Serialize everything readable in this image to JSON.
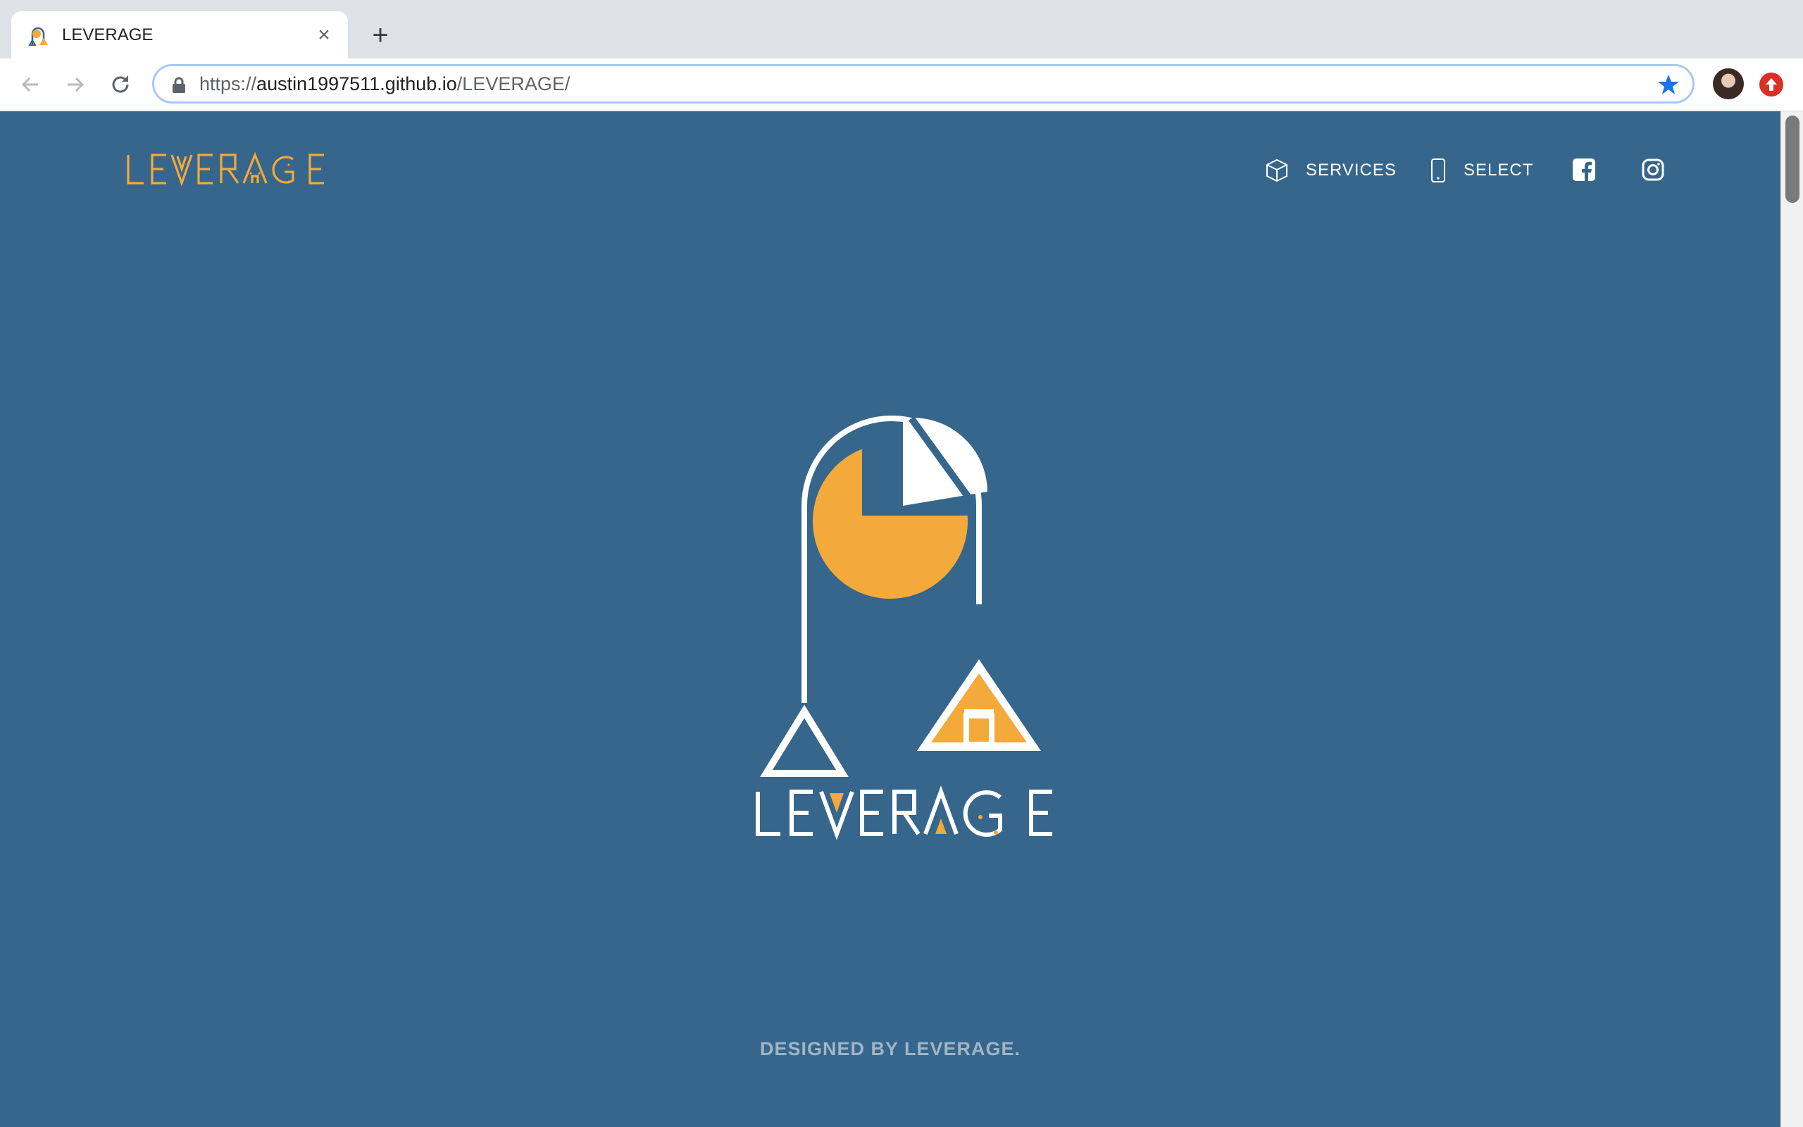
{
  "browser": {
    "tab_title": "LEVERAGE",
    "tab_close_glyph": "×",
    "new_tab_glyph": "+",
    "url_prefix": "https://",
    "url_host": "austin1997511.github.io",
    "url_path": "/LEVERAGE/",
    "icons": [
      "back-arrow-icon",
      "forward-arrow-icon",
      "reload-icon",
      "lock-icon",
      "star-icon",
      "avatar",
      "update-icon"
    ]
  },
  "site": {
    "brand": "LEVERAGE",
    "nav": {
      "services_label": "SERVICES",
      "select_label": "SELECT"
    },
    "social_icons": [
      "facebook-icon",
      "instagram-icon"
    ],
    "hero_wordmark": "LEVERAGE",
    "footer_text": "DESIGNED BY LEVERAGE."
  },
  "colors": {
    "page_background": "#36668b",
    "brand_accent": "#f4a93b",
    "hero_white": "#ffffff",
    "footer_text": "#9fb6c8"
  }
}
